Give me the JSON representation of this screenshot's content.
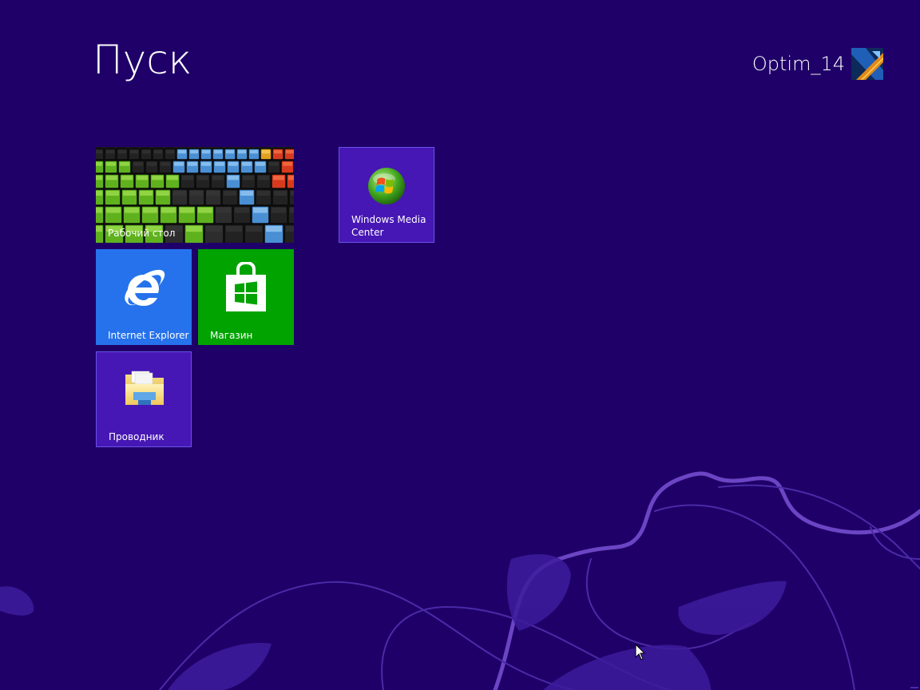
{
  "start": {
    "title": "Пуск"
  },
  "user": {
    "name": "Optim_14",
    "avatar_icon": "user-avatar-icon"
  },
  "colors": {
    "background": "#1f0068",
    "tile_purple": "#4617b4",
    "tile_ie_blue": "#2672ec",
    "tile_store_green": "#00a300",
    "tile_border": "#6a52e8",
    "swirl": "#6b45c4"
  },
  "tiles": {
    "desktop": {
      "label": "Рабочий стол",
      "icon": "desktop-wallpaper"
    },
    "wmc": {
      "label": "Windows Media\nCenter",
      "icon": "windows-media-center-icon"
    },
    "ie": {
      "label": "Internet Explorer",
      "icon": "internet-explorer-icon"
    },
    "store": {
      "label": "Магазин",
      "icon": "store-bag-icon"
    },
    "explorer": {
      "label": "Проводник",
      "icon": "folder-icon"
    }
  }
}
